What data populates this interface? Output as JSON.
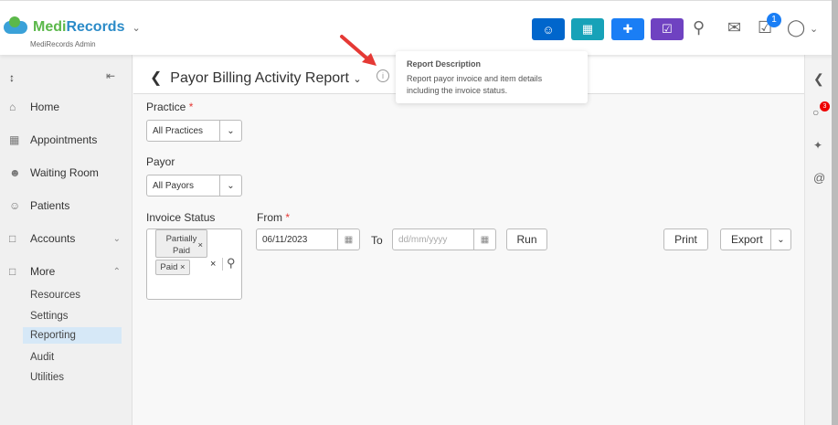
{
  "header": {
    "brand_a": "Medi",
    "brand_b": "Records",
    "subtitle": "MediRecords Admin",
    "notification_count": "1",
    "colors": {
      "add_patient": "#0066cc",
      "appointment": "#17a2b8",
      "medical": "#1a7ef5",
      "clipboard": "#6f42c1"
    }
  },
  "sidebar": {
    "items": [
      {
        "label": "Home",
        "icon": "home-icon"
      },
      {
        "label": "Appointments",
        "icon": "calendar-icon"
      },
      {
        "label": "Waiting Room",
        "icon": "users-icon"
      },
      {
        "label": "Patients",
        "icon": "user-icon"
      },
      {
        "label": "Accounts",
        "icon": "folder-icon"
      },
      {
        "label": "More",
        "icon": "folder-open-icon"
      }
    ],
    "subitems": [
      "Resources",
      "Settings",
      "Reporting",
      "Audit",
      "Utilities"
    ]
  },
  "page": {
    "title": "Payor Billing Activity Report"
  },
  "tooltip": {
    "title": "Report Description",
    "text": "Report payor invoice and item details including the invoice status."
  },
  "form": {
    "practice_label": "Practice",
    "practice_value": "All Practices",
    "payor_label": "Payor",
    "payor_value": "All Payors",
    "status_label": "Invoice Status",
    "status_tags": [
      "Partially Paid",
      "Paid"
    ],
    "from_label": "From",
    "from_value": "06/11/2023",
    "to_label": "To",
    "to_placeholder": "dd/mm/yyyy",
    "run": "Run",
    "print": "Print",
    "export": "Export",
    "required": "*"
  },
  "rail": {
    "chat_count": "3"
  }
}
